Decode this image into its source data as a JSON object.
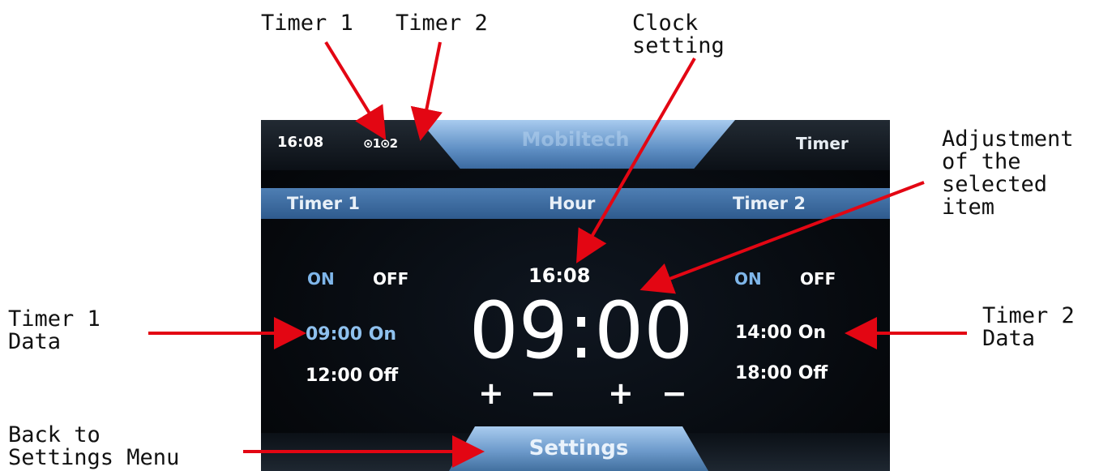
{
  "annotations": {
    "timer1": "Timer 1",
    "timer2": "Timer 2",
    "clock_setting": "Clock\nsetting",
    "adjustment": "Adjustment\nof the\nselected\nitem",
    "timer1_data": "Timer 1\nData",
    "timer2_data": "Timer 2\nData",
    "back_settings": "Back to\nSettings Menu"
  },
  "screen": {
    "top_bar": {
      "clock": "16:08",
      "timer_icons": "⊙1⊙2",
      "brand": "Mobiltech",
      "title": "Timer"
    },
    "header": {
      "left": "Timer 1",
      "center": "Hour",
      "right": "Timer 2"
    },
    "timer1": {
      "on": "ON",
      "off": "OFF",
      "on_time": "09:00 On",
      "off_time": "12:00 Off"
    },
    "timer2": {
      "on": "ON",
      "off": "OFF",
      "on_time": "14:00 On",
      "off_time": "18:00 Off"
    },
    "current_time": "16:08",
    "selected_value": "09:00",
    "controls": {
      "hour_plus": "+",
      "hour_minus": "−",
      "minute_plus": "+",
      "minute_minus": "−"
    },
    "bottom_tab": "Settings"
  },
  "colors": {
    "annotation_arrow": "#e30613",
    "accent_blue": "#4e7eb3",
    "selected_text": "#8fc1ee"
  }
}
